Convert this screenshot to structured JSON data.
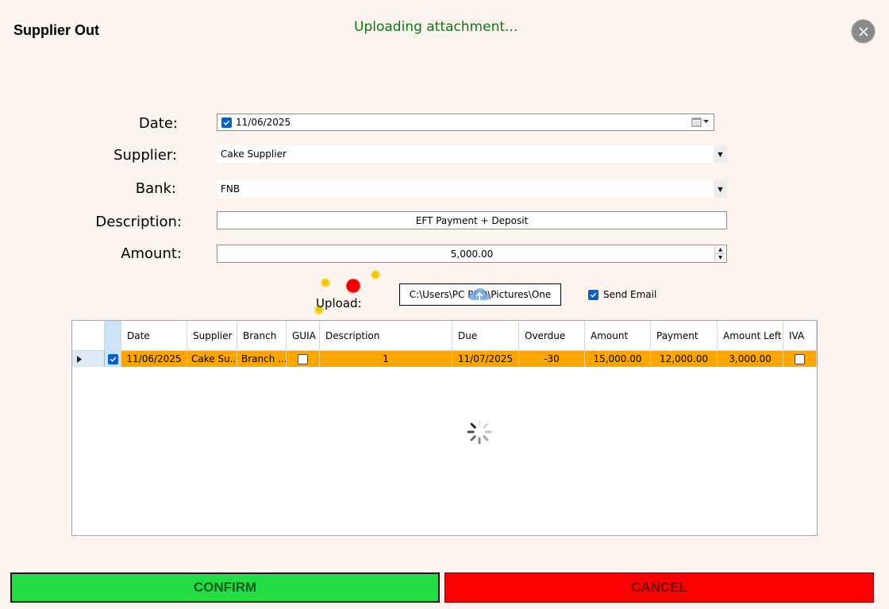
{
  "window": {
    "title": "Supplier Out",
    "status": "Uploading attachment..."
  },
  "form": {
    "date_label": "Date:",
    "date_value": "11/06/2025",
    "supplier_label": "Supplier:",
    "supplier_value": "Cake Supplier",
    "bank_label": "Bank:",
    "bank_value": "FNB",
    "description_label": "Description:",
    "description_value": "EFT Payment + Deposit",
    "amount_label": "Amount:",
    "amount_value": "5,000.00",
    "upload_label": "Upload:",
    "upload_path": "C:\\Users\\PC PRO\\Pictures\\One",
    "send_email_label": "Send Email",
    "send_email_checked": true
  },
  "grid": {
    "columns": [
      "Date",
      "Supplier",
      "Branch",
      "GUIA",
      "Description",
      "Due",
      "Overdue",
      "Amount",
      "Payment",
      "Amount Left",
      "IVA"
    ],
    "rows": [
      {
        "selected": true,
        "date": "11/06/2025",
        "supplier": "Cake Su...",
        "branch": "Branch ...",
        "guia": false,
        "description": "1",
        "due": "11/07/2025",
        "overdue": "-30",
        "amount": "15,000.00",
        "payment": "12,000.00",
        "amount_left": "3,000.00",
        "iva": false
      }
    ]
  },
  "buttons": {
    "confirm": "CONFIRM",
    "cancel": "CANCEL"
  },
  "colors": {
    "background": "#fdf3ef",
    "status_text": "#0a7a14",
    "row_highlight": "#ffa500",
    "confirm": "#22dd44",
    "cancel": "#ff0000",
    "checkbox": "#0b5fc8"
  },
  "icons": {
    "close": "close-icon",
    "calendar": "calendar-icon",
    "loading": "loading-spinner-icon"
  }
}
